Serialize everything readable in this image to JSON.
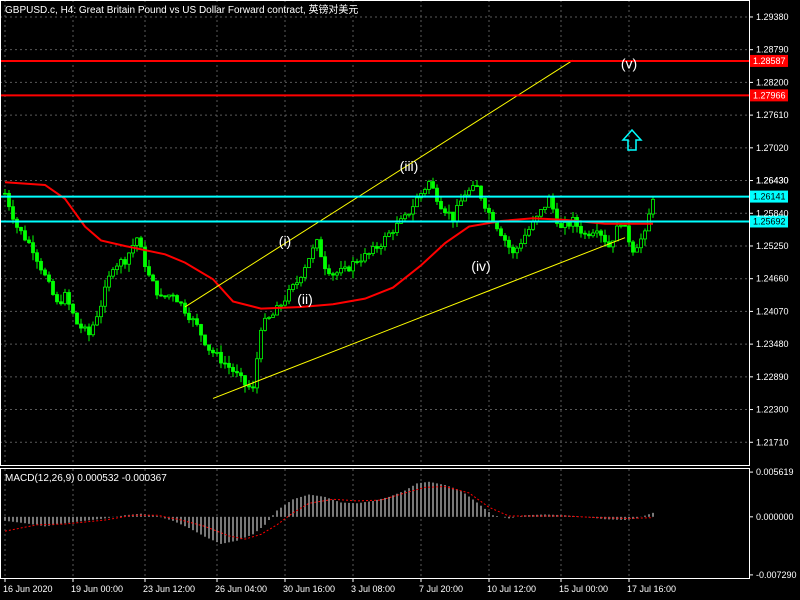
{
  "header": {
    "title": "GBPUSD.c, H4:  Great Britain Pound vs US Dollar Forward contract, 英镑对美元",
    "indicator_label": "MACD(12,26,9) 0.000532 -0.000367"
  },
  "colors": {
    "background": "#000000",
    "bull_candle": "#00ff00",
    "bear_candle": "#00ff00",
    "grid": "#5a5a5a",
    "moving_average": "#ff0000",
    "channel": "#ffff00",
    "resistance": "#ff0000",
    "support": "#00ffff",
    "macd_hist": "#c8c8c8",
    "macd_signal": "#ff0000",
    "arrow": "#00ffff"
  },
  "chart_data": [
    {
      "type": "candlestick",
      "symbol": "GBPUSD.c",
      "timeframe": "H4",
      "ylim": [
        1.213,
        1.2965
      ],
      "y_ticks": [
        "1.29380",
        "1.28790",
        "1.28200",
        "1.27610",
        "1.27020",
        "1.26430",
        "1.25840",
        "1.25250",
        "1.24660",
        "1.24070",
        "1.23480",
        "1.22890",
        "1.22300",
        "1.21710"
      ],
      "x_ticks": [
        "16 Jun 2020",
        "19 Jun 00:00",
        "23 Jun 12:00",
        "26 Jun 04:00",
        "30 Jun 16:00",
        "3 Jul 08:00",
        "7 Jul 20:00",
        "10 Jul 12:00",
        "15 Jul 00:00",
        "17 Jul 16:00"
      ],
      "candle_count": 125,
      "close_path": [
        [
          0,
          1.262
        ],
        [
          3,
          1.256
        ],
        [
          7,
          1.252
        ],
        [
          10,
          1.247
        ],
        [
          13,
          1.242
        ],
        [
          15,
          1.2435
        ],
        [
          18,
          1.2385
        ],
        [
          21,
          1.2365
        ],
        [
          24,
          1.242
        ],
        [
          27,
          1.249
        ],
        [
          30,
          1.25
        ],
        [
          33,
          1.254
        ],
        [
          36,
          1.247
        ],
        [
          39,
          1.243
        ],
        [
          42,
          1.244
        ],
        [
          45,
          1.241
        ],
        [
          48,
          1.238
        ],
        [
          51,
          1.234
        ],
        [
          54,
          1.232
        ],
        [
          57,
          1.23
        ],
        [
          60,
          1.2275
        ],
        [
          62,
          1.2265
        ],
        [
          64,
          1.238
        ],
        [
          67,
          1.24
        ],
        [
          70,
          1.243
        ],
        [
          73,
          1.246
        ],
        [
          76,
          1.2505
        ],
        [
          78,
          1.253
        ],
        [
          80,
          1.249
        ],
        [
          82,
          1.2475
        ],
        [
          85,
          1.248
        ],
        [
          88,
          1.25
        ],
        [
          91,
          1.251
        ],
        [
          94,
          1.253
        ],
        [
          97,
          1.2555
        ],
        [
          100,
          1.2575
        ],
        [
          103,
          1.261
        ],
        [
          106,
          1.264
        ],
        [
          109,
          1.26
        ],
        [
          112,
          1.2575
        ],
        [
          115,
          1.262
        ],
        [
          118,
          1.263
        ],
        [
          121,
          1.2585
        ],
        [
          124,
          1.255
        ],
        [
          127,
          1.251
        ],
        [
          130,
          1.2545
        ],
        [
          133,
          1.2575
        ],
        [
          136,
          1.261
        ],
        [
          139,
          1.2555
        ],
        [
          142,
          1.257
        ],
        [
          145,
          1.2545
        ],
        [
          148,
          1.256
        ],
        [
          151,
          1.2525
        ],
        [
          154,
          1.257
        ],
        [
          157,
          1.252
        ],
        [
          160,
          1.2545
        ],
        [
          162,
          1.2615
        ]
      ],
      "moving_average": [
        [
          0,
          1.264
        ],
        [
          10,
          1.2635
        ],
        [
          15,
          1.261
        ],
        [
          20,
          1.256
        ],
        [
          24,
          1.2535
        ],
        [
          30,
          1.2525
        ],
        [
          40,
          1.251
        ],
        [
          45,
          1.2495
        ],
        [
          52,
          1.2465
        ],
        [
          57,
          1.2425
        ],
        [
          64,
          1.2412
        ],
        [
          74,
          1.2415
        ],
        [
          82,
          1.242
        ],
        [
          90,
          1.243
        ],
        [
          97,
          1.245
        ],
        [
          104,
          1.249
        ],
        [
          110,
          1.253
        ],
        [
          116,
          1.256
        ],
        [
          124,
          1.257
        ],
        [
          132,
          1.2575
        ],
        [
          140,
          1.2572
        ],
        [
          150,
          1.2565
        ],
        [
          162,
          1.2565
        ]
      ],
      "channel": {
        "upper": [
          [
            45,
            1.2415
          ],
          [
            142,
            1.286
          ]
        ],
        "lower": [
          [
            52,
            1.225
          ],
          [
            155,
            1.254
          ]
        ]
      },
      "horizontal_levels": [
        {
          "price": 1.28587,
          "label": "1.28587",
          "kind": "resistance"
        },
        {
          "price": 1.27966,
          "label": "1.27966",
          "kind": "resistance"
        },
        {
          "price": 1.26141,
          "label": "1.26141",
          "kind": "support"
        },
        {
          "price": 1.25692,
          "label": "1.25692",
          "kind": "support"
        }
      ],
      "current_price": "1.26430",
      "wave_labels": [
        {
          "text": "(i)",
          "x": 70,
          "y": 1.2525
        },
        {
          "text": "(ii)",
          "x": 75,
          "y": 1.242
        },
        {
          "text": "(iii)",
          "x": 101,
          "y": 1.266
        },
        {
          "text": "(iv)",
          "x": 119,
          "y": 1.248
        },
        {
          "text": "(v)",
          "x": 156,
          "y": 1.2845
        }
      ]
    },
    {
      "type": "bar",
      "name": "MACD(12,26,9)",
      "values_label": [
        "0.000532",
        "-0.000367"
      ],
      "ylim": [
        -0.00768,
        0.00588
      ],
      "y_ticks": [
        "0.005619",
        "0.000000",
        "-0.007290"
      ],
      "hist_path": [
        [
          0,
          -0.0005
        ],
        [
          5,
          -0.0008
        ],
        [
          10,
          -0.0012
        ],
        [
          15,
          -0.0008
        ],
        [
          20,
          -0.0005
        ],
        [
          25,
          -0.0002
        ],
        [
          30,
          0.0002
        ],
        [
          34,
          0.0004
        ],
        [
          38,
          0.0001
        ],
        [
          42,
          -0.0005
        ],
        [
          46,
          -0.0014
        ],
        [
          50,
          -0.0025
        ],
        [
          54,
          -0.0034
        ],
        [
          58,
          -0.003
        ],
        [
          62,
          -0.0022
        ],
        [
          65,
          -0.001
        ],
        [
          68,
          0.0008
        ],
        [
          72,
          0.0022
        ],
        [
          76,
          0.0028
        ],
        [
          80,
          0.0025
        ],
        [
          84,
          0.0018
        ],
        [
          88,
          0.0017
        ],
        [
          92,
          0.002
        ],
        [
          96,
          0.0025
        ],
        [
          100,
          0.0033
        ],
        [
          103,
          0.0042
        ],
        [
          106,
          0.0044
        ],
        [
          110,
          0.004
        ],
        [
          114,
          0.0033
        ],
        [
          118,
          0.0018
        ],
        [
          122,
          0.0002
        ],
        [
          126,
          -0.0002
        ],
        [
          130,
          0.0002
        ],
        [
          135,
          0.0003
        ],
        [
          140,
          0.0002
        ],
        [
          145,
          0.0
        ],
        [
          150,
          -0.0003
        ],
        [
          155,
          -0.0004
        ],
        [
          158,
          -0.0002
        ],
        [
          162,
          0.0005
        ]
      ],
      "signal": [
        [
          0,
          -0.0018
        ],
        [
          8,
          -0.001
        ],
        [
          15,
          -0.0009
        ],
        [
          25,
          -0.0004
        ],
        [
          32,
          0.0002
        ],
        [
          38,
          0.0002
        ],
        [
          44,
          -0.0004
        ],
        [
          50,
          -0.0012
        ],
        [
          56,
          -0.0024
        ],
        [
          60,
          -0.0028
        ],
        [
          64,
          -0.0022
        ],
        [
          68,
          -0.001
        ],
        [
          72,
          0.0005
        ],
        [
          76,
          0.0017
        ],
        [
          82,
          0.0022
        ],
        [
          88,
          0.002
        ],
        [
          94,
          0.0021
        ],
        [
          100,
          0.003
        ],
        [
          105,
          0.0037
        ],
        [
          110,
          0.0038
        ],
        [
          116,
          0.003
        ],
        [
          121,
          0.0012
        ],
        [
          126,
          0.0001
        ],
        [
          132,
          0.0001
        ],
        [
          140,
          0.0001
        ],
        [
          148,
          -0.0001
        ],
        [
          156,
          -0.0002
        ],
        [
          162,
          -0.0001
        ]
      ]
    }
  ]
}
